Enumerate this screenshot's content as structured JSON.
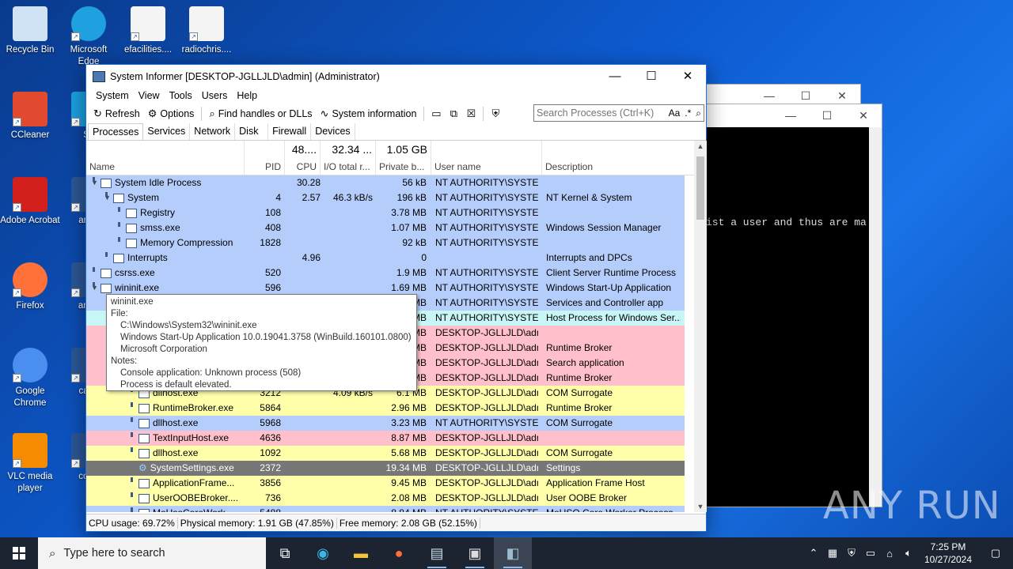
{
  "desktop": {
    "icons": [
      {
        "label": "Recycle Bin",
        "icon": "recycle-bin-icon"
      },
      {
        "label": "Microsoft Edge",
        "icon": "edge-icon"
      },
      {
        "label": "efacilities....",
        "icon": "image-file-icon"
      },
      {
        "label": "radiochris....",
        "icon": "image-file-icon"
      },
      {
        "label": "CCleaner",
        "icon": "ccleaner-icon"
      },
      {
        "label": "Sk",
        "icon": "skype-icon"
      },
      {
        "label": "Adobe Acrobat",
        "icon": "acrobat-icon"
      },
      {
        "label": "amat",
        "icon": "word-doc-icon"
      },
      {
        "label": "Firefox",
        "icon": "firefox-icon"
      },
      {
        "label": "amer",
        "icon": "word-doc-icon"
      },
      {
        "label": "Google Chrome",
        "icon": "chrome-icon"
      },
      {
        "label": "cana",
        "icon": "word-doc-icon"
      },
      {
        "label": "VLC media player",
        "icon": "vlc-icon"
      },
      {
        "label": "comr",
        "icon": "word-doc-icon"
      }
    ]
  },
  "console": {
    "text": "ist a user and thus are ma"
  },
  "window": {
    "title": "System Informer [DESKTOP-JGLLJLD\\admin] (Administrator)",
    "menu": [
      "System",
      "View",
      "Tools",
      "Users",
      "Help"
    ],
    "toolbar": {
      "refresh": "Refresh",
      "options": "Options",
      "find_handles": "Find handles or DLLs",
      "system_information": "System information"
    },
    "search_placeholder": "Search Processes (Ctrl+K)",
    "search_aa": "Aa",
    "tabs": [
      "Processes",
      "Services",
      "Network",
      "Disk",
      "Firewall",
      "Devices"
    ],
    "columns": {
      "name": "Name",
      "pid": "PID",
      "cpu": "CPU",
      "cpu_total": "48....",
      "io": "I/O total r...",
      "io_total": "32.34 ...",
      "private": "Private b...",
      "private_total": "1.05 GB",
      "user": "User name",
      "description": "Description"
    },
    "processes": [
      {
        "name": "System Idle Process",
        "indent": 0,
        "expand": "▼",
        "pid": "",
        "cpu": "30.28",
        "io": "",
        "priv": "56 kB",
        "user": "NT AUTHORITY\\SYSTEM",
        "desc": "",
        "bg": "#b4cdfa"
      },
      {
        "name": "System",
        "indent": 1,
        "expand": "▼",
        "pid": "4",
        "cpu": "2.57",
        "io": "46.3 kB/s",
        "priv": "196 kB",
        "user": "NT AUTHORITY\\SYSTEM",
        "desc": "NT Kernel & System",
        "bg": "#b4cdfa"
      },
      {
        "name": "Registry",
        "indent": 2,
        "expand": "",
        "pid": "108",
        "cpu": "",
        "io": "",
        "priv": "3.78 MB",
        "user": "NT AUTHORITY\\SYSTEM",
        "desc": "",
        "bg": "#b4cdfa"
      },
      {
        "name": "smss.exe",
        "indent": 2,
        "expand": "",
        "pid": "408",
        "cpu": "",
        "io": "",
        "priv": "1.07 MB",
        "user": "NT AUTHORITY\\SYSTEM",
        "desc": "Windows Session Manager",
        "bg": "#b4cdfa"
      },
      {
        "name": "Memory Compression",
        "indent": 2,
        "expand": "",
        "pid": "1828",
        "cpu": "",
        "io": "",
        "priv": "92 kB",
        "user": "NT AUTHORITY\\SYSTEM",
        "desc": "",
        "bg": "#b4cdfa"
      },
      {
        "name": "Interrupts",
        "indent": 1,
        "expand": "",
        "pid": "",
        "cpu": "4.96",
        "io": "",
        "priv": "0",
        "user": "",
        "desc": "Interrupts and DPCs",
        "bg": "#b4cdfa"
      },
      {
        "name": "csrss.exe",
        "indent": 0,
        "expand": "",
        "pid": "520",
        "cpu": "",
        "io": "",
        "priv": "1.9 MB",
        "user": "NT AUTHORITY\\SYSTEM",
        "desc": "Client Server Runtime Process",
        "bg": "#b4cdfa"
      },
      {
        "name": "wininit.exe",
        "indent": 0,
        "expand": "▼",
        "pid": "596",
        "cpu": "",
        "io": "",
        "priv": "1.69 MB",
        "user": "NT AUTHORITY\\SYSTEM",
        "desc": "Windows Start-Up Application",
        "bg": "#b4cdfa"
      },
      {
        "name": "",
        "indent": 1,
        "expand": "",
        "pid": "",
        "cpu": "",
        "io": "",
        "priv": "MB",
        "user": "NT AUTHORITY\\SYSTEM",
        "desc": "Services and Controller app",
        "bg": "#b4cdfa"
      },
      {
        "name": "",
        "indent": 2,
        "expand": "",
        "pid": "",
        "cpu": "",
        "io": "",
        "priv": "MB",
        "user": "NT AUTHORITY\\SYSTEM",
        "desc": "Host Process for Windows Ser...",
        "bg": "#c8f5f5"
      },
      {
        "name": "",
        "indent": 3,
        "expand": "",
        "pid": "",
        "cpu": "",
        "io": "",
        "priv": "MB",
        "user": "DESKTOP-JGLLJLD\\admi",
        "desc": "",
        "bg": "#ffc0cb"
      },
      {
        "name": "",
        "indent": 3,
        "expand": "",
        "pid": "",
        "cpu": "",
        "io": "",
        "priv": "MB",
        "user": "DESKTOP-JGLLJLD\\admi",
        "desc": "Runtime Broker",
        "bg": "#ffc0cb"
      },
      {
        "name": "",
        "indent": 3,
        "expand": "",
        "pid": "",
        "cpu": "",
        "io": "",
        "priv": "MB",
        "user": "DESKTOP-JGLLJLD\\admi",
        "desc": "Search application",
        "bg": "#ffc0cb"
      },
      {
        "name": "",
        "indent": 3,
        "expand": "",
        "pid": "",
        "cpu": "",
        "io": "",
        "priv": "MB",
        "user": "DESKTOP-JGLLJLD\\admi",
        "desc": "Runtime Broker",
        "bg": "#ffc0cb"
      },
      {
        "name": "dllhost.exe",
        "indent": 3,
        "expand": "",
        "pid": "3212",
        "cpu": "",
        "io": "4.09 kB/s",
        "priv": "6.1 MB",
        "user": "DESKTOP-JGLLJLD\\admi",
        "desc": "COM Surrogate",
        "bg": "#ffffaa"
      },
      {
        "name": "RuntimeBroker.exe",
        "indent": 3,
        "expand": "",
        "pid": "5864",
        "cpu": "",
        "io": "",
        "priv": "2.96 MB",
        "user": "DESKTOP-JGLLJLD\\admi",
        "desc": "Runtime Broker",
        "bg": "#ffffaa"
      },
      {
        "name": "dllhost.exe",
        "indent": 3,
        "expand": "",
        "pid": "5968",
        "cpu": "",
        "io": "",
        "priv": "3.23 MB",
        "user": "NT AUTHORITY\\SYSTEM",
        "desc": "COM Surrogate",
        "bg": "#b4cdfa"
      },
      {
        "name": "TextInputHost.exe",
        "indent": 3,
        "expand": "",
        "pid": "4636",
        "cpu": "",
        "io": "",
        "priv": "8.87 MB",
        "user": "DESKTOP-JGLLJLD\\admi",
        "desc": "",
        "bg": "#ffc0cb"
      },
      {
        "name": "dllhost.exe",
        "indent": 3,
        "expand": "",
        "pid": "1092",
        "cpu": "",
        "io": "",
        "priv": "5.68 MB",
        "user": "DESKTOP-JGLLJLD\\admi",
        "desc": "COM Surrogate",
        "bg": "#ffffaa"
      },
      {
        "name": "SystemSettings.exe",
        "indent": 3,
        "expand": "",
        "pid": "2372",
        "cpu": "",
        "io": "",
        "priv": "19.34 MB",
        "user": "DESKTOP-JGLLJLD\\admi",
        "desc": "Settings",
        "bg": "#777777",
        "fg": "#ffffff",
        "gear": true
      },
      {
        "name": "ApplicationFrame...",
        "indent": 3,
        "expand": "",
        "pid": "3856",
        "cpu": "",
        "io": "",
        "priv": "9.45 MB",
        "user": "DESKTOP-JGLLJLD\\admi",
        "desc": "Application Frame Host",
        "bg": "#ffffaa"
      },
      {
        "name": "UserOOBEBroker....",
        "indent": 3,
        "expand": "",
        "pid": "736",
        "cpu": "",
        "io": "",
        "priv": "2.08 MB",
        "user": "DESKTOP-JGLLJLD\\admi",
        "desc": "User OOBE Broker",
        "bg": "#ffffaa"
      },
      {
        "name": "MoUsoCoreWork...",
        "indent": 3,
        "expand": "",
        "pid": "5488",
        "cpu": "",
        "io": "",
        "priv": "8.84 MB",
        "user": "NT AUTHORITY\\SYSTEM",
        "desc": "MoUSO Core Worker Process",
        "bg": "#b4cdfa"
      }
    ],
    "tooltip": {
      "title": "wininit.exe",
      "file_label": "File:",
      "path": "C:\\Windows\\System32\\wininit.exe",
      "version": "Windows Start-Up Application 10.0.19041.3758 (WinBuild.160101.0800)",
      "company": "Microsoft Corporation",
      "notes_label": "Notes:",
      "note1": "Console application: Unknown process (508)",
      "note2": "Process is default elevated."
    },
    "status": {
      "cpu": "CPU usage: 69.72%",
      "physical": "Physical memory: 1.91 GB (47.85%)",
      "free": "Free memory: 2.08 GB (52.15%)"
    }
  },
  "taskbar": {
    "search_placeholder": "Type here to search",
    "time": "7:25 PM",
    "date": "10/27/2024"
  },
  "watermark": "ANY RUN"
}
